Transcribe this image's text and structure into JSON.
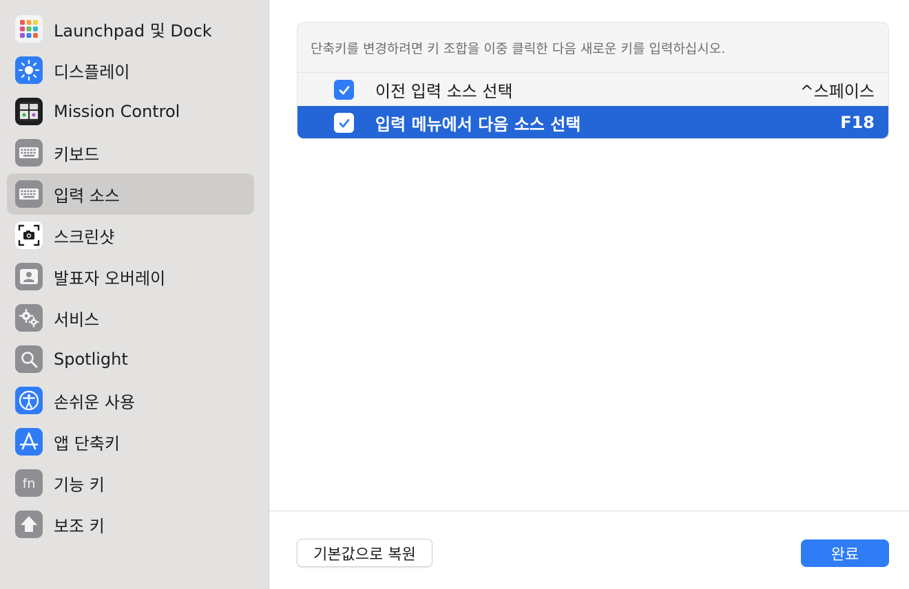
{
  "sidebar": {
    "items": [
      {
        "label": "Launchpad 및 Dock",
        "icon": "launchpad-icon"
      },
      {
        "label": "디스플레이",
        "icon": "display-icon"
      },
      {
        "label": "Mission Control",
        "icon": "mission-control-icon"
      },
      {
        "label": "키보드",
        "icon": "keyboard-icon"
      },
      {
        "label": "입력 소스",
        "icon": "input-sources-icon",
        "selected": true
      },
      {
        "label": "스크린샷",
        "icon": "screenshot-icon"
      },
      {
        "label": "발표자 오버레이",
        "icon": "presenter-overlay-icon"
      },
      {
        "label": "서비스",
        "icon": "services-icon"
      },
      {
        "label": "Spotlight",
        "icon": "spotlight-icon"
      },
      {
        "label": "손쉬운 사용",
        "icon": "accessibility-icon"
      },
      {
        "label": "앱 단축키",
        "icon": "app-shortcuts-icon"
      },
      {
        "label": "기능 키",
        "icon": "function-keys-icon"
      },
      {
        "label": "보조 키",
        "icon": "modifier-keys-icon"
      }
    ]
  },
  "main": {
    "instruction": "단축키를 변경하려면 키 조합을 이중 클릭한 다음 새로운 키를 입력하십시오.",
    "shortcuts": [
      {
        "label": "이전 입력 소스 선택",
        "key": "^스페이스",
        "checked": true,
        "selected": false
      },
      {
        "label": "입력 메뉴에서 다음 소스 선택",
        "key": "F18",
        "checked": true,
        "selected": true
      }
    ]
  },
  "footer": {
    "restore_label": "기본값으로 복원",
    "done_label": "완료"
  },
  "colors": {
    "accent": "#2f7cf6",
    "selection": "#2466d8",
    "sidebar_bg": "#e3e2e1",
    "sidebar_selected": "#cfcdcc"
  }
}
